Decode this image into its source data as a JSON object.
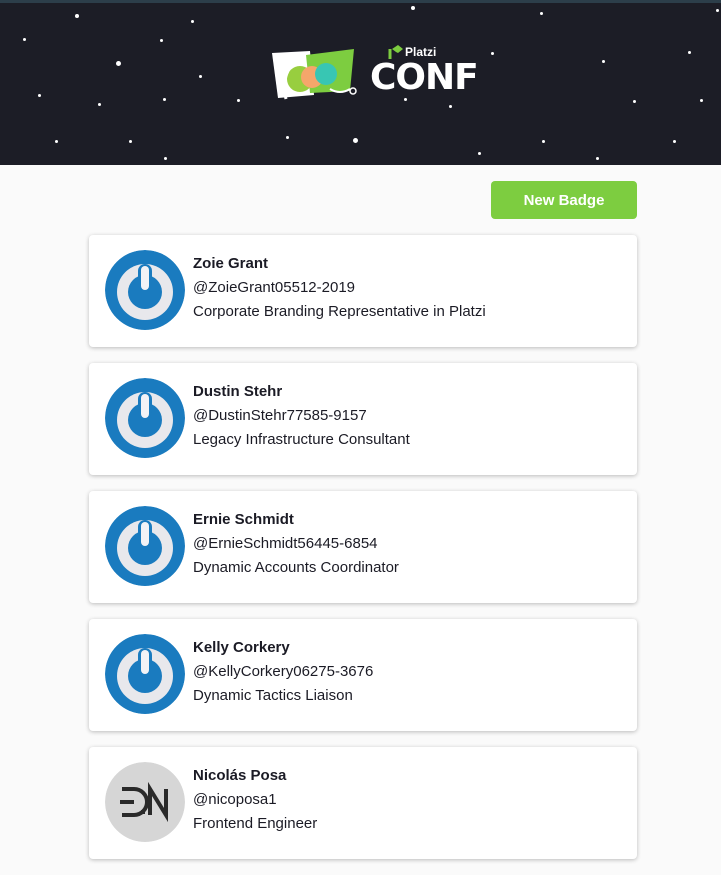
{
  "header": {
    "logo_brand": "Platzi",
    "logo_text": "CONF"
  },
  "toolbar": {
    "new_badge_label": "New Badge"
  },
  "badges": [
    {
      "name": "Zoie Grant",
      "handle": "@ZoieGrant05512-2019",
      "job_title": "Corporate Branding Representative in Platzi",
      "avatar": "power-icon-avatar"
    },
    {
      "name": "Dustin Stehr",
      "handle": "@DustinStehr77585-9157",
      "job_title": "Legacy Infrastructure Consultant",
      "avatar": "power-icon-avatar"
    },
    {
      "name": "Ernie Schmidt",
      "handle": "@ErnieSchmidt56445-6854",
      "job_title": "Dynamic Accounts Coordinator",
      "avatar": "power-icon-avatar"
    },
    {
      "name": "Kelly Corkery",
      "handle": "@KellyCorkery06275-3676",
      "job_title": "Dynamic Tactics Liaison",
      "avatar": "power-icon-avatar"
    },
    {
      "name": "Nicolás Posa",
      "handle": "@nicoposa1",
      "job_title": "Frontend Engineer",
      "avatar": "dn-monogram-avatar"
    }
  ],
  "colors": {
    "header_bg": "#1c1d26",
    "button_green": "#7dcd40",
    "avatar_blue": "#1a7bbf"
  }
}
